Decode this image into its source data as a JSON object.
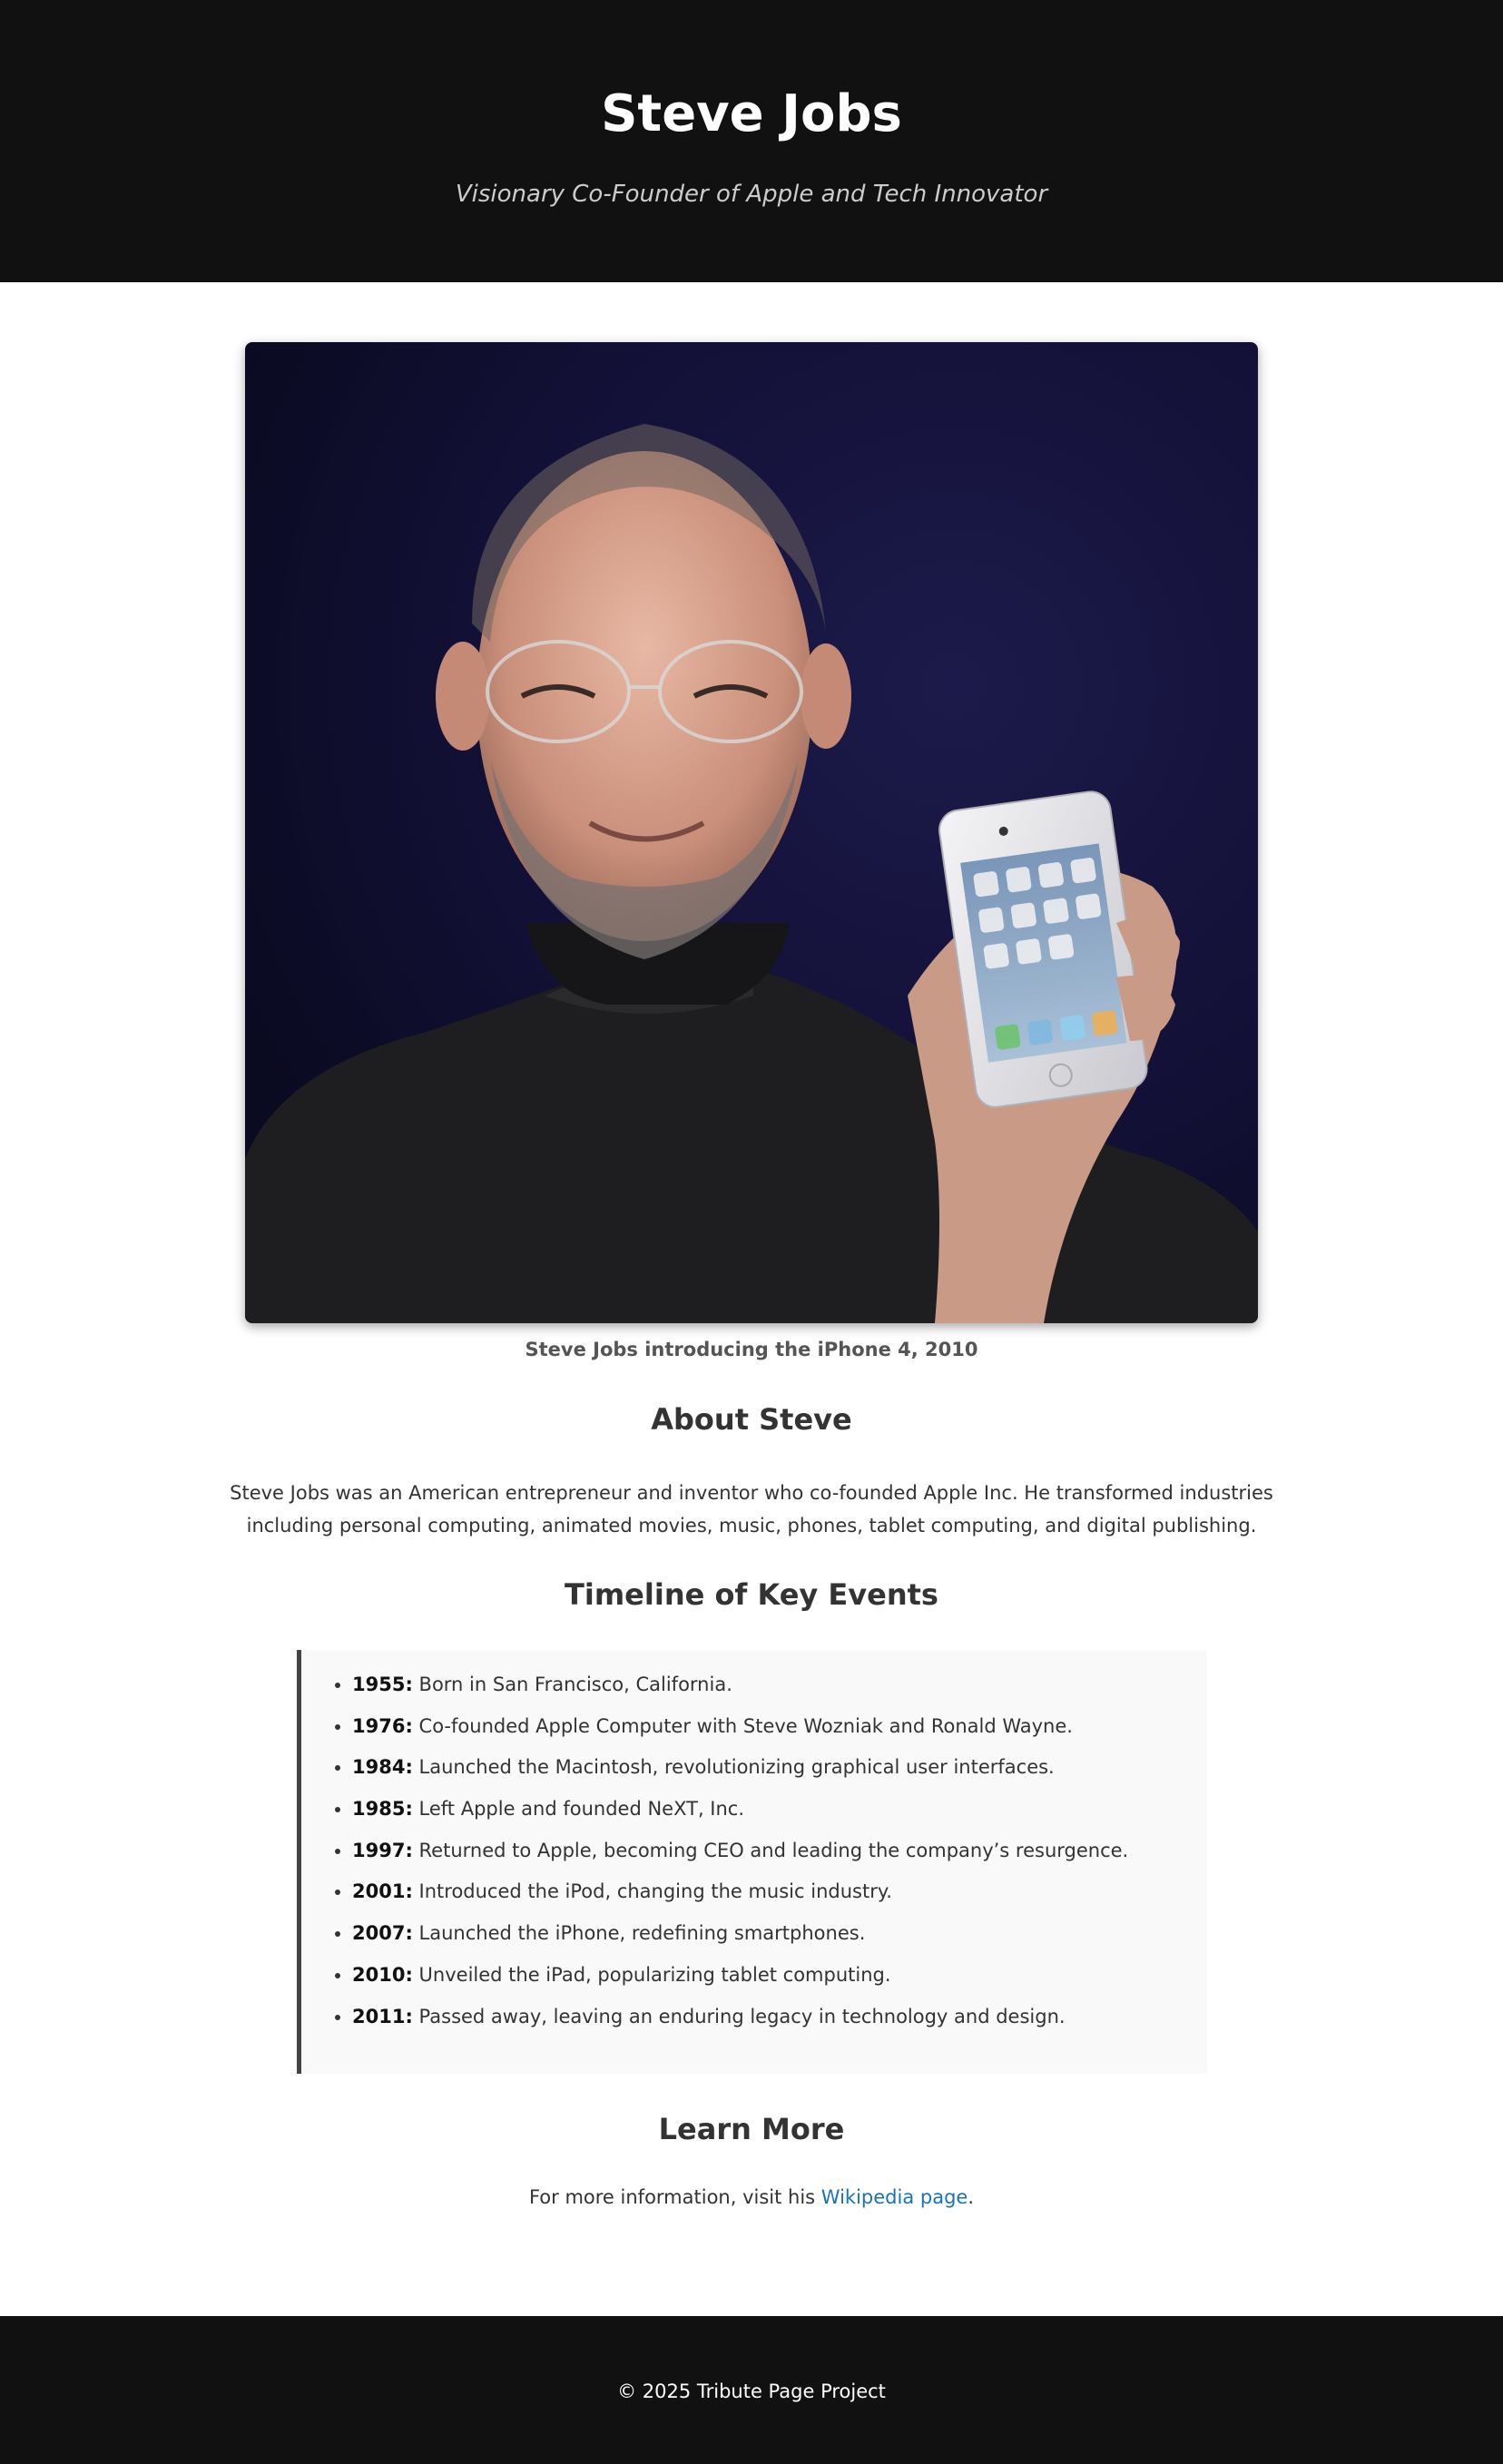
{
  "header": {
    "title": "Steve Jobs",
    "subtitle": "Visionary Co-Founder of Apple and Tech Innovator"
  },
  "figure": {
    "caption": "Steve Jobs introducing the iPhone 4, 2010"
  },
  "about": {
    "heading": "About Steve",
    "text": "Steve Jobs was an American entrepreneur and inventor who co-founded Apple Inc. He transformed industries including personal computing, animated movies, music, phones, tablet computing, and digital publishing."
  },
  "timeline": {
    "heading": "Timeline of Key Events",
    "items": [
      {
        "year": "1955:",
        "text": " Born in San Francisco, California."
      },
      {
        "year": "1976:",
        "text": " Co-founded Apple Computer with Steve Wozniak and Ronald Wayne."
      },
      {
        "year": "1984:",
        "text": " Launched the Macintosh, revolutionizing graphical user interfaces."
      },
      {
        "year": "1985:",
        "text": " Left Apple and founded NeXT, Inc."
      },
      {
        "year": "1997:",
        "text": " Returned to Apple, becoming CEO and leading the company’s resurgence."
      },
      {
        "year": "2001:",
        "text": " Introduced the iPod, changing the music industry."
      },
      {
        "year": "2007:",
        "text": " Launched the iPhone, redefining smartphones."
      },
      {
        "year": "2010:",
        "text": " Unveiled the iPad, popularizing tablet computing."
      },
      {
        "year": "2011:",
        "text": " Passed away, leaving an enduring legacy in technology and design."
      }
    ]
  },
  "learn_more": {
    "heading": "Learn More",
    "text_before": "For more information, visit his ",
    "link_label": "Wikipedia page",
    "text_after": "."
  },
  "footer": {
    "text": "© 2025 Tribute Page Project"
  },
  "colors": {
    "header_bg": "#111111",
    "link": "#1a73b8",
    "timeline_border": "#444444"
  }
}
